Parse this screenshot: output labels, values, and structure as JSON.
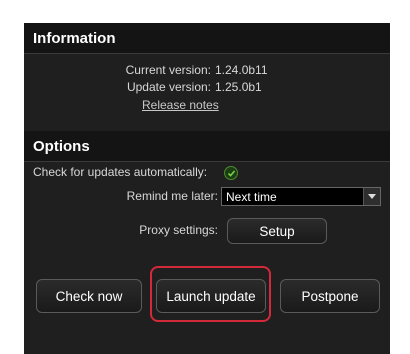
{
  "information": {
    "heading": "Information",
    "current_version_label": "Current version:",
    "current_version": "1.24.0b11",
    "update_version_label": "Update version:",
    "update_version": "1.25.0b1",
    "release_notes_link": "Release notes"
  },
  "options": {
    "heading": "Options",
    "auto_check_label": "Check for updates automatically:",
    "auto_check_enabled": true,
    "remind_label": "Remind me later:",
    "remind_value": "Next time",
    "proxy_label": "Proxy settings:",
    "proxy_button": "Setup"
  },
  "actions": {
    "check_now": "Check now",
    "launch_update": "Launch update",
    "postpone": "Postpone"
  },
  "colors": {
    "panel_bg": "#1f1f1f",
    "header_bg": "#141414",
    "highlight": "#d22a3b",
    "check_green": "#4d8a2e"
  }
}
